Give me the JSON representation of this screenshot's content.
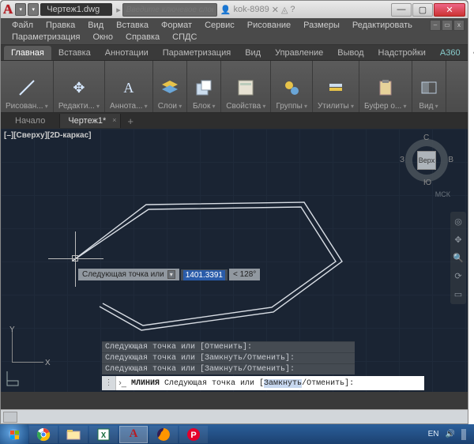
{
  "titlebar": {
    "doc_name": "Чертеж1.dwg",
    "search_placeholder": "Введите ключевое слово/фразу",
    "user": "kok-8989"
  },
  "win_controls": {
    "min": "—",
    "max": "▢",
    "close": "✕"
  },
  "menubar": {
    "row1": [
      "Файл",
      "Правка",
      "Вид",
      "Вставка",
      "Формат",
      "Сервис",
      "Рисование",
      "Размеры",
      "Редактировать"
    ],
    "row2": [
      "Параметризация",
      "Окно",
      "Справка",
      "СПДС"
    ]
  },
  "ribbon_tabs": [
    "Главная",
    "Вставка",
    "Аннотации",
    "Параметризация",
    "Вид",
    "Управление",
    "Вывод",
    "Надстройки",
    "A360"
  ],
  "ribbon_panels": [
    {
      "label": "Рисован...",
      "icon": "line"
    },
    {
      "label": "Редакти...",
      "icon": "move"
    },
    {
      "label": "Аннота...",
      "icon": "text-A"
    },
    {
      "label": "Слои",
      "icon": "layers"
    },
    {
      "label": "Блок",
      "icon": "block"
    },
    {
      "label": "Свойства",
      "icon": "props"
    },
    {
      "label": "Группы",
      "icon": "groups"
    },
    {
      "label": "Утилиты",
      "icon": "utils"
    },
    {
      "label": "Буфер о...",
      "icon": "clip"
    },
    {
      "label": "Вид",
      "icon": "view"
    }
  ],
  "file_tabs": {
    "inactive": "Начало",
    "active": "Чертеж1*"
  },
  "viewport_label": "[–][Сверху][2D-каркас]",
  "viewcube": {
    "face": "Верх",
    "n": "С",
    "s": "Ю",
    "e": "В",
    "w": "З",
    "wcs": "МСК"
  },
  "ucs": {
    "x": "X",
    "y": "Y"
  },
  "dynamic_input": {
    "prompt": "Следующая точка или",
    "distance": "1401.3391",
    "angle": "< 128°"
  },
  "cmd_history": [
    "Следующая точка или [Отменить]:",
    "Следующая точка или [Замкнуть/Отменить]:",
    "Следующая точка или [Замкнуть/Отменить]:"
  ],
  "cmd_line": {
    "cmd": "МЛИНИЯ",
    "rest": " Следующая точка или [",
    "opt": "Замкнуть",
    "rest2": "/Отменить]:"
  },
  "taskbar": {
    "apps": [
      "chrome",
      "explorer",
      "excel",
      "autocad",
      "firefox",
      "p"
    ],
    "lang": "EN"
  }
}
